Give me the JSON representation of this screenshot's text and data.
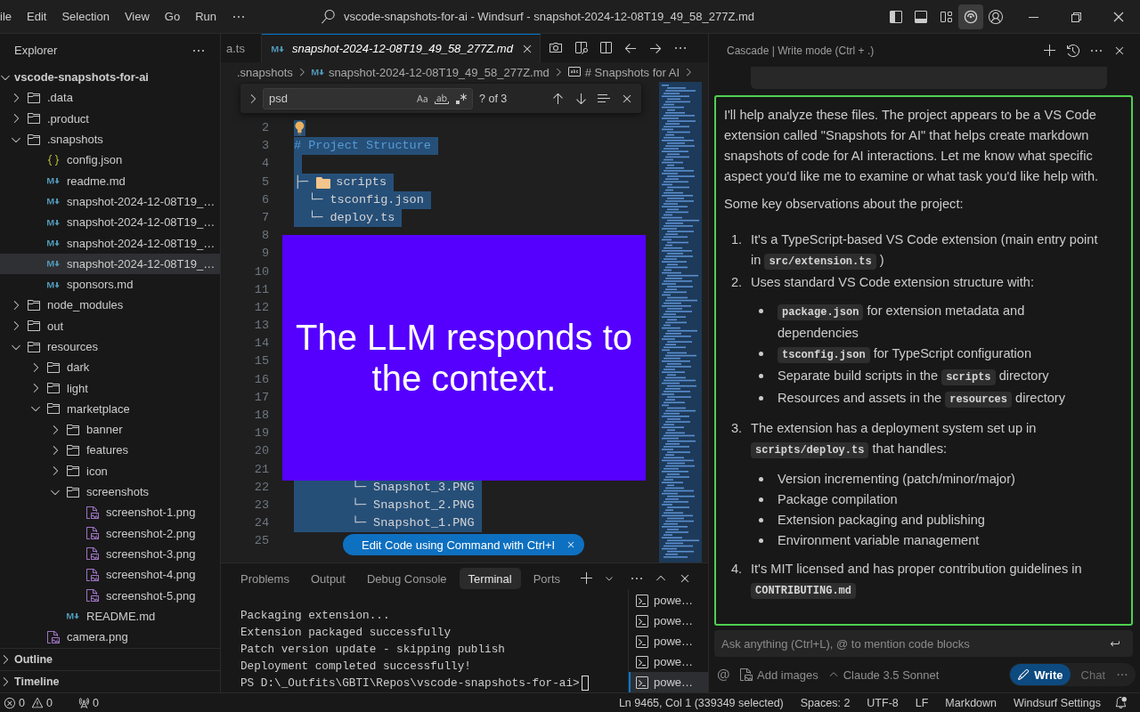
{
  "title_bar": {
    "menu": [
      "ile",
      "Edit",
      "Selection",
      "View",
      "Go",
      "Run"
    ],
    "title": "vscode-snapshots-for-ai - Windsurf - snapshot-2024-12-08T19_49_58_277Z.md",
    "layout_buttons": [
      {
        "selected": false
      },
      {
        "selected": false
      },
      {
        "selected": false
      },
      {
        "selected": true
      }
    ]
  },
  "explorer": {
    "title": "Explorer",
    "root": {
      "label": "vscode-snapshots-for-ai",
      "expanded": true,
      "children": [
        {
          "kind": "folder",
          "label": ".data",
          "expanded": false,
          "selected": false
        },
        {
          "kind": "folder",
          "label": ".product",
          "expanded": false,
          "selected": false
        },
        {
          "kind": "folder",
          "label": ".snapshots",
          "expanded": true,
          "selected": false,
          "children": [
            {
              "kind": "json",
              "label": "config.json",
              "selected": false
            },
            {
              "kind": "markdown",
              "label": "readme.md",
              "selected": false
            },
            {
              "kind": "markdown",
              "label": "snapshot-2024-12-08T19_…",
              "selected": false
            },
            {
              "kind": "markdown",
              "label": "snapshot-2024-12-08T19_…",
              "selected": false
            },
            {
              "kind": "markdown",
              "label": "snapshot-2024-12-08T19_…",
              "selected": false
            },
            {
              "kind": "markdown",
              "label": "snapshot-2024-12-08T19_…",
              "selected": true
            },
            {
              "kind": "markdown",
              "label": "sponsors.md",
              "selected": false
            }
          ]
        },
        {
          "kind": "folder",
          "label": "node_modules",
          "expanded": false,
          "selected": false
        },
        {
          "kind": "folder",
          "label": "out",
          "expanded": false,
          "selected": false
        },
        {
          "kind": "folder",
          "label": "resources",
          "expanded": true,
          "selected": false,
          "children": [
            {
              "kind": "folder",
              "label": "dark",
              "expanded": false,
              "selected": false
            },
            {
              "kind": "folder",
              "label": "light",
              "expanded": false,
              "selected": false
            },
            {
              "kind": "folder",
              "label": "marketplace",
              "expanded": true,
              "selected": false,
              "children": [
                {
                  "kind": "folder",
                  "label": "banner",
                  "expanded": false,
                  "selected": false
                },
                {
                  "kind": "folder",
                  "label": "features",
                  "expanded": false,
                  "selected": false
                },
                {
                  "kind": "folder",
                  "label": "icon",
                  "expanded": false,
                  "selected": false
                },
                {
                  "kind": "folder",
                  "label": "screenshots",
                  "expanded": true,
                  "selected": false,
                  "children": [
                    {
                      "kind": "image",
                      "label": "screenshot-1.png",
                      "selected": false
                    },
                    {
                      "kind": "image",
                      "label": "screenshot-2.png",
                      "selected": false
                    },
                    {
                      "kind": "image",
                      "label": "screenshot-3.png",
                      "selected": false
                    },
                    {
                      "kind": "image",
                      "label": "screenshot-4.png",
                      "selected": false
                    },
                    {
                      "kind": "image",
                      "label": "screenshot-5.png",
                      "selected": false
                    }
                  ]
                },
                {
                  "kind": "markdown",
                  "label": "README.md",
                  "selected": false
                }
              ]
            },
            {
              "kind": "image",
              "label": "camera.png",
              "selected": false
            }
          ]
        }
      ]
    },
    "sections": [
      {
        "label": "Outline",
        "expanded": false
      },
      {
        "label": "Timeline",
        "expanded": false
      }
    ]
  },
  "editor": {
    "tabs": [
      {
        "label": "a.ts",
        "kind": "plain",
        "selected": false,
        "preview": false
      },
      {
        "label": "snapshot-2024-12-08T19_49_58_277Z.md",
        "kind": "markdown",
        "selected": true,
        "preview": true
      }
    ],
    "breadcrumb": [
      {
        "kind": "folder",
        "label": ".snapshots"
      },
      {
        "kind": "markdown",
        "label": "snapshot-2024-12-08T19_49_58_277Z.md"
      },
      {
        "kind": "symbol",
        "label": "# Snapshots for AI"
      }
    ],
    "find": {
      "value": "psd",
      "result": "? of 3"
    },
    "lines": [
      {
        "number": "2",
        "kind": "hint"
      },
      {
        "number": "3",
        "kind": "heading",
        "text": "# Project Structure"
      },
      {
        "number": "4",
        "kind": "blank"
      },
      {
        "number": "5",
        "kind": "folder",
        "prefix": "├─ ",
        "text": "scripts"
      },
      {
        "number": "6",
        "kind": "file",
        "text": "  └─ tsconfig.json"
      },
      {
        "number": "7",
        "kind": "file",
        "text": "  └─ deploy.ts"
      },
      {
        "number": "8"
      },
      {
        "number": "9"
      },
      {
        "number": "10"
      },
      {
        "number": "11"
      },
      {
        "number": "12"
      },
      {
        "number": "13"
      },
      {
        "number": "14"
      },
      {
        "number": "15"
      },
      {
        "number": "16"
      },
      {
        "number": "17"
      },
      {
        "number": "18"
      },
      {
        "number": "19"
      },
      {
        "number": "20"
      },
      {
        "number": "21"
      },
      {
        "number": "22",
        "kind": "file",
        "text": "        └─ Snapshot_3.PNG"
      },
      {
        "number": "23",
        "kind": "file",
        "text": "        └─ Snapshot_2.PNG"
      },
      {
        "number": "24",
        "kind": "file",
        "text": "        └─ Snapshot_1.PNG"
      },
      {
        "number": "25"
      }
    ],
    "caption": "The LLM responds to the context.",
    "hint": "Edit Code using Command with Ctrl+I"
  },
  "panel": {
    "tabs": [
      {
        "label": "Problems",
        "selected": false
      },
      {
        "label": "Output",
        "selected": false
      },
      {
        "label": "Debug Console",
        "selected": false
      },
      {
        "label": "Terminal",
        "selected": true
      },
      {
        "label": "Ports",
        "selected": false
      }
    ],
    "output": [
      "Packaging extension...",
      "Extension packaged successfully",
      "Patch version update - skipping publish",
      "Deployment completed successfully!"
    ],
    "prompt": "PS D:\\_Outfits\\GBTI\\Repos\\vscode-snapshots-for-ai>",
    "terminals": [
      {
        "label": "powe…",
        "selected": false
      },
      {
        "label": "powe…",
        "selected": false
      },
      {
        "label": "powe…",
        "selected": false
      },
      {
        "label": "powe…",
        "selected": false
      },
      {
        "label": "powe…",
        "selected": true
      }
    ]
  },
  "cascade": {
    "title": "Cascade | Write mode (Ctrl + .)",
    "paragraphs": [
      "I'll help analyze these files. The project appears to be a VS Code extension called \"Snapshots for AI\" that helps create markdown snapshots of code for AI interactions. Let me know what specific aspect you'd like me to examine or what task you'd like help with.",
      "Some key observations about the project:"
    ],
    "items": [
      {
        "marker": "1.",
        "parts": [
          {
            "kind": "text",
            "text": "It's a TypeScript-based VS Code extension (main entry point in "
          },
          {
            "kind": "code",
            "text": "src/extension.ts"
          },
          {
            "kind": "text",
            "text": " )"
          }
        ]
      },
      {
        "marker": "2.",
        "parts": [
          {
            "kind": "text",
            "text": "Uses standard VS Code extension structure with:"
          }
        ],
        "bullets": [
          [
            {
              "kind": "code",
              "text": "package.json"
            },
            {
              "kind": "text",
              "text": " for extension metadata and dependencies"
            }
          ],
          [
            {
              "kind": "code",
              "text": "tsconfig.json"
            },
            {
              "kind": "text",
              "text": " for TypeScript configuration"
            }
          ],
          [
            {
              "kind": "text",
              "text": "Separate build scripts in the "
            },
            {
              "kind": "code",
              "text": "scripts"
            },
            {
              "kind": "text",
              "text": " directory"
            }
          ],
          [
            {
              "kind": "text",
              "text": "Resources and assets in the "
            },
            {
              "kind": "code",
              "text": "resources"
            },
            {
              "kind": "text",
              "text": " directory"
            }
          ]
        ]
      },
      {
        "marker": "3.",
        "parts": [
          {
            "kind": "text",
            "text": "The extension has a deployment system set up in "
          },
          {
            "kind": "code",
            "text": "scripts/deploy.ts"
          },
          {
            "kind": "text",
            "text": " that handles:"
          }
        ],
        "bullets": [
          [
            {
              "kind": "text",
              "text": "Version incrementing (patch/minor/major)"
            }
          ],
          [
            {
              "kind": "text",
              "text": "Package compilation"
            }
          ],
          [
            {
              "kind": "text",
              "text": "Extension packaging and publishing"
            }
          ],
          [
            {
              "kind": "text",
              "text": "Environment variable management"
            }
          ]
        ]
      },
      {
        "marker": "4.",
        "parts": [
          {
            "kind": "text",
            "text": "It's MIT licensed and has proper contribution guidelines in "
          },
          {
            "kind": "code",
            "text": "CONTRIBUTING.md"
          }
        ]
      }
    ],
    "input": {
      "placeholder": "Ask anything (Ctrl+L), @ to mention code blocks"
    },
    "add_images": "Add images",
    "model": "Claude 3.5 Sonnet",
    "modes": [
      {
        "label": "Write",
        "selected": true
      },
      {
        "label": "Chat",
        "selected": false
      }
    ]
  },
  "status_bar": {
    "errors": "0",
    "warnings": "0",
    "ports": "0",
    "items": [
      "Ln 9465, Col 1 (339349 selected)",
      "Spaces: 2",
      "UTF-8",
      "LF",
      "Markdown",
      "Windsurf Settings"
    ]
  }
}
